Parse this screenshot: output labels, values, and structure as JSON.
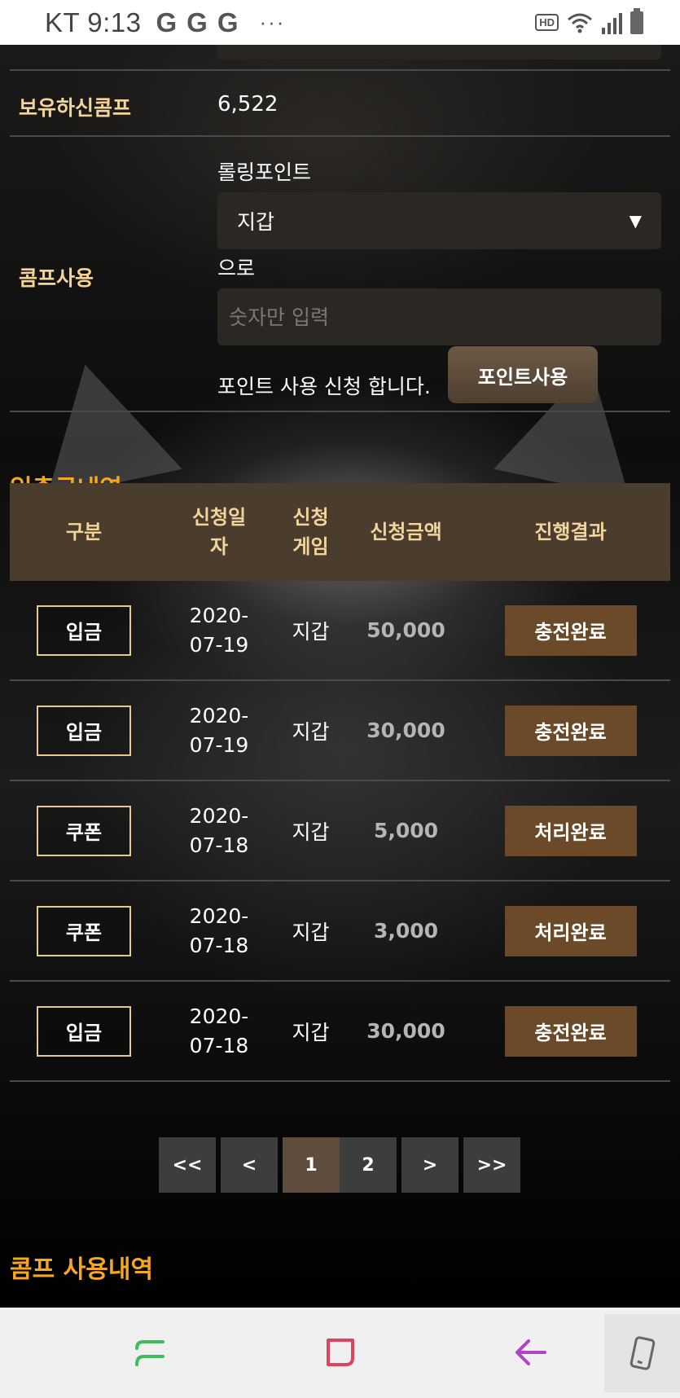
{
  "status_bar": {
    "carrier_time": "KT 9:13",
    "g_icons": [
      "G",
      "G",
      "G"
    ],
    "more": "···",
    "hd": "HD",
    "icons": [
      "hd-voice-icon",
      "wifi-icon",
      "signal-icon",
      "battery-icon"
    ]
  },
  "comp": {
    "owned_label": "보유하신콤프",
    "owned_value": "6,522",
    "use_label": "콤프사용",
    "rolling_label": "롤링포인트",
    "select_value": "지갑",
    "to_label": "으로",
    "amount_placeholder": "숫자만 입력",
    "apply_text": "포인트 사용 신청 합니다.",
    "apply_button": "포인트사용"
  },
  "history": {
    "title": "입출금내역",
    "columns": [
      "구분",
      "신청일\n자",
      "신청\n게임",
      "신청금액",
      "진행결과"
    ],
    "rows": [
      {
        "type": "입금",
        "date": "2020-\n07-19",
        "game": "지갑",
        "amount": "50,000",
        "result": "충전완료"
      },
      {
        "type": "입금",
        "date": "2020-\n07-19",
        "game": "지갑",
        "amount": "30,000",
        "result": "충전완료"
      },
      {
        "type": "쿠폰",
        "date": "2020-\n07-18",
        "game": "지갑",
        "amount": "5,000",
        "result": "처리완료"
      },
      {
        "type": "쿠폰",
        "date": "2020-\n07-18",
        "game": "지갑",
        "amount": "3,000",
        "result": "처리완료"
      },
      {
        "type": "입금",
        "date": "2020-\n07-18",
        "game": "지갑",
        "amount": "30,000",
        "result": "충전완료"
      }
    ]
  },
  "pagination": {
    "first": "<<",
    "prev": "<",
    "pages": [
      "1",
      "2"
    ],
    "current": "1",
    "next": ">",
    "last": ">>"
  },
  "comp_history": {
    "title": "콤프 사용내역"
  },
  "colors": {
    "accent_orange": "#f5a623",
    "label_gold": "#f3d49a",
    "header_brown": "#4a3d2e",
    "result_brown": "#6b4a29"
  },
  "nav_bar": {
    "icons": [
      "recent-apps-icon",
      "home-icon",
      "back-icon",
      "rotate-screen-icon"
    ]
  }
}
